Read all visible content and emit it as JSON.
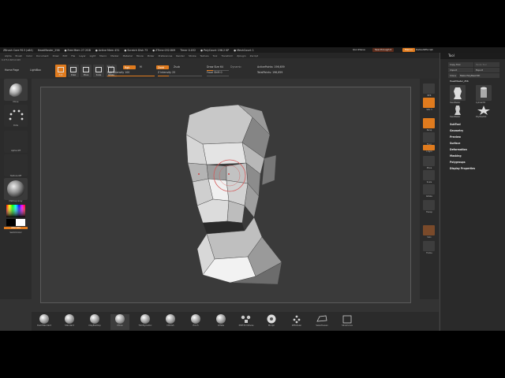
{
  "title_bar": {
    "items": [
      "ZBrush Core R13 (x64)",
      "HeadMaster_256",
      "● Free Mem 27.2GB",
      "● Active Mem 431",
      "● Scratch Disk 73",
      "● ZTime 032.809",
      "Timer 0.032",
      "● PolyCount 196.2 KP",
      "● MeshCount 1"
    ],
    "quicksave": "QuickSave",
    "see_through": "See-through 0",
    "menus": "Menus",
    "default_script": "DefaultZScript"
  },
  "menu_bar": [
    "Alpha",
    "Brush",
    "Color",
    "Document",
    "Draw",
    "Edit",
    "File",
    "Layer",
    "Light",
    "Macro",
    "Marker",
    "Material",
    "Movie",
    "Picker",
    "Preferences",
    "Render",
    "Stroke",
    "Texture",
    "Tool",
    "Transform",
    "Zplugin",
    "Zscript"
  ],
  "shelf": {
    "home_page": "Home Page",
    "lightbox": "LightBox",
    "buttons": [
      "Edit",
      "Draw",
      "Move",
      "Scale",
      "Rotate"
    ],
    "mrgb": "Mrgb",
    "rgb": "Rgb",
    "m": "M",
    "zadd": "Zadd",
    "zsub": "Zsub",
    "rgb_intensity": "Rgb Intensity 100",
    "z_intensity": "Z Intensity 25",
    "draw_size": "Draw Size 64",
    "dynamic": "Dynamic",
    "focal_shift": "Focal Shift 0",
    "active_points": "ActivePoints: 196,659",
    "total_points": "TotalPoints: 196,659",
    "coords": "0.473,0.603,0.628"
  },
  "left_panel": {
    "brush_label": "Move",
    "stroke_label": "Dots",
    "alpha_label": "Alpha Off",
    "texture_label": "Texture Off",
    "material_label": "MatCap Gray",
    "gradient_label": "Gradient",
    "switch_color": "SwitchColor",
    "alternate": "Alternate"
  },
  "right_column": [
    "BPR",
    "SPix 3",
    "Persp",
    "Floor",
    "L.Sym",
    "Move",
    "Scale",
    "Rotate",
    "Transp",
    "Solo",
    "Frame"
  ],
  "tool_panel": {
    "title": "Tool",
    "copy_tool": "Copy Tool",
    "paste_tool": "Paste Tool",
    "import": "Import",
    "export": "Export",
    "clone": "Clone",
    "make_polymesh": "Make PolyMesh3D",
    "current_tool": "HeadMaster_256",
    "thumbs": [
      "HeadMaster",
      "Cylinder3D",
      "PolyMesh3D",
      "HeadMaster"
    ],
    "sections": [
      "SubTool",
      "Geometry",
      "Preview",
      "Surface",
      "Deformation",
      "Masking",
      "Polygroups",
      "Display Properties"
    ]
  },
  "bottom_tray": [
    "DamStandard",
    "Standard",
    "ClayBuildup",
    "Move",
    "TrimDynamic",
    "hPolish",
    "Pinch",
    "Inflate",
    "IMM Primitives",
    "Morph",
    "ZModeler",
    "SelectLasso",
    "SliceCurve"
  ],
  "accent_color": "#e07b1e"
}
